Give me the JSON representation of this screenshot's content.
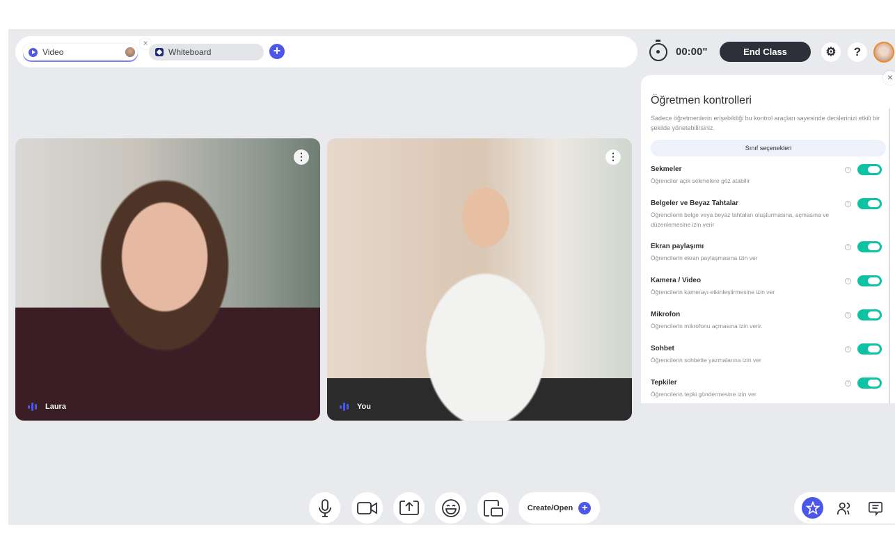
{
  "tabs": [
    {
      "label": "Video",
      "active": true
    },
    {
      "label": "Whiteboard",
      "active": false
    }
  ],
  "header": {
    "timer": "00:00\"",
    "end_class": "End Class"
  },
  "videos": [
    {
      "name": "Laura"
    },
    {
      "name": "You"
    }
  ],
  "panel": {
    "title": "Öğretmen kontrolleri",
    "description": "Sadece öğretmenlerin erişebildiği bu kontrol araçları sayesinde derslerinizi etkili bir şekilde yönetebilirsiniz.",
    "class_options": "Sınıf seçenekleri",
    "settings": [
      {
        "title": "Sekmeler",
        "desc": "Öğrenciler açık sekmelere göz atabilir",
        "enabled": true
      },
      {
        "title": "Belgeler ve Beyaz Tahtalar",
        "desc": "Öğrencilerin belge veya beyaz tahtaları oluşturmasına, açmasına ve düzenlemesine izin verir",
        "enabled": true
      },
      {
        "title": "Ekran paylaşımı",
        "desc": "Öğrencilerin ekran paylaşmasına izin ver",
        "enabled": true
      },
      {
        "title": "Kamera / Video",
        "desc": "Öğrencilerin kamerayı etkinleştirmesine izin ver",
        "enabled": true
      },
      {
        "title": "Mikrofon",
        "desc": "Öğrencilerin mikrofonu açmasına izin verir.",
        "enabled": true
      },
      {
        "title": "Sohbet",
        "desc": "Öğrencilerin sohbette yazmalarına izin ver",
        "enabled": true
      },
      {
        "title": "Tepkiler",
        "desc": "Öğrencilerin tepki göndermesine izin ver",
        "enabled": true
      }
    ]
  },
  "toolbar": {
    "create_open": "Create/Open"
  },
  "colors": {
    "accent": "#4c56e8",
    "toggle_on": "#0fc2a3",
    "end_class_bg": "#2d3038"
  }
}
